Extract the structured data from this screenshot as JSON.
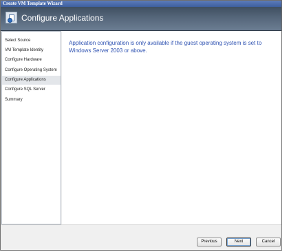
{
  "window": {
    "title": "Create VM Template Wizard"
  },
  "header": {
    "title": "Configure Applications",
    "icon": "wizard-template-icon"
  },
  "sidebar": {
    "items": [
      {
        "label": "Select Source",
        "active": false
      },
      {
        "label": "VM Template Identity",
        "active": false
      },
      {
        "label": "Configure Hardware",
        "active": false
      },
      {
        "label": "Configure Operating System",
        "active": false
      },
      {
        "label": "Configure Applications",
        "active": true
      },
      {
        "label": "Configure SQL Server",
        "active": false
      },
      {
        "label": "Summary",
        "active": false
      }
    ]
  },
  "main": {
    "message": "Application configuration is only available if the guest operating system is set to Windows Server 2003 or above."
  },
  "footer": {
    "previous_label": "Previous",
    "next_label": "Next",
    "cancel_label": "Cancel"
  },
  "colors": {
    "message_text": "#2b4fb0",
    "header_bg": "#55667a",
    "titlebar_bg": "#4a6aab"
  }
}
